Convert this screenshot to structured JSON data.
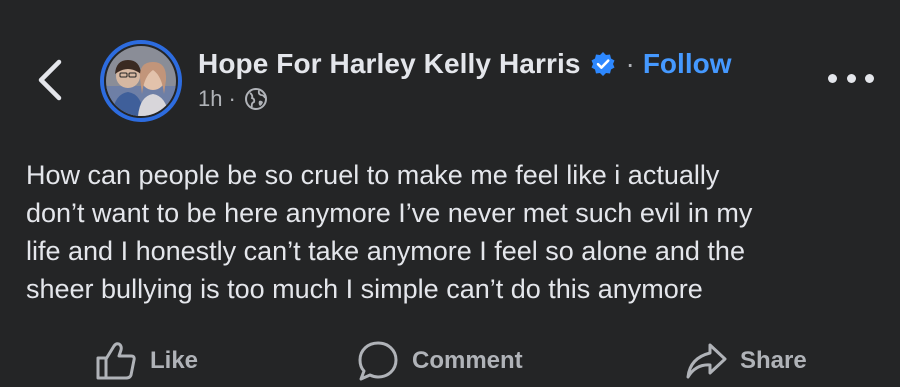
{
  "header": {
    "back_icon": "chevron-left-icon",
    "author_name": "Hope For Harley Kelly Harris",
    "verified_icon": "verified-badge-icon",
    "separator": "·",
    "follow_label": "Follow",
    "time": "1h",
    "meta_separator": "·",
    "audience_icon": "globe-icon",
    "more_icon": "more-horizontal-icon"
  },
  "post": {
    "lines": [
      "How can people be so cruel to make me feel like i actually",
      "don’t want to be here anymore I’ve never met such evil in my",
      "life and I honestly can’t take anymore I feel so alone and the",
      "sheer bullying is too much I simple can’t do this anymore"
    ]
  },
  "actions": {
    "like_label": "Like",
    "comment_label": "Comment",
    "share_label": "Share"
  },
  "colors": {
    "background": "#242526",
    "text": "#e4e6eb",
    "secondary_text": "#b0b3b8",
    "link_blue": "#4599ff",
    "avatar_ring": "#2d6cdf"
  }
}
